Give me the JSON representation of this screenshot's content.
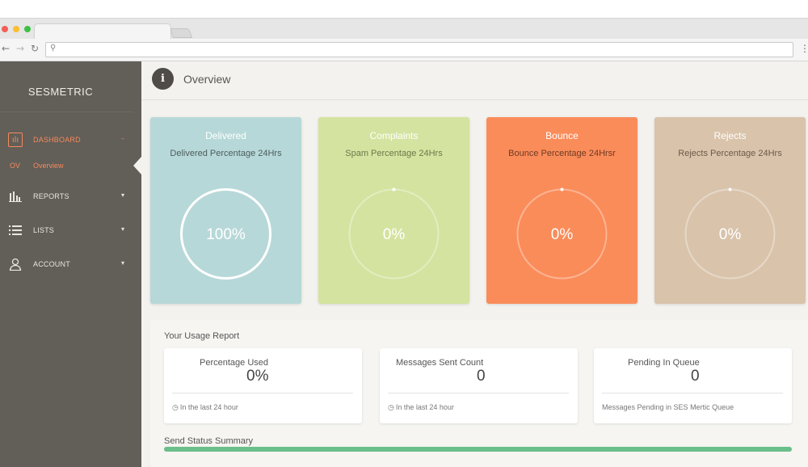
{
  "app": {
    "brand": "SESMETRIC",
    "page_title": "Overview"
  },
  "sidebar": {
    "items": [
      {
        "label": "DASHBOARD",
        "icon": "chart-icon",
        "caret": "–",
        "active": true
      },
      {
        "label": "REPORTS",
        "icon": "bar-chart-icon",
        "caret": "▾"
      },
      {
        "label": "LISTS",
        "icon": "list-icon",
        "caret": "▾"
      },
      {
        "label": "ACCOUNT",
        "icon": "user-icon",
        "caret": "▾"
      }
    ],
    "sub_item": {
      "code": "OV",
      "label": "Overview"
    }
  },
  "cards": [
    {
      "title": "Delivered",
      "subtitle": "Delivered Percentage 24Hrs",
      "value": "100%",
      "percent": 100,
      "bg": "#b7d8d8",
      "title_color": "#ffffff",
      "sub_color": "#4d5c5c"
    },
    {
      "title": "Complaints",
      "subtitle": "Spam Percentage 24Hrs",
      "value": "0%",
      "percent": 0,
      "bg": "#d4e3a0",
      "title_color": "#ffffff",
      "sub_color": "#6b7a4a"
    },
    {
      "title": "Bounce",
      "subtitle": "Bounce Percentage 24Hrsr",
      "value": "0%",
      "percent": 0,
      "bg": "#fa8c5a",
      "title_color": "#ffffff",
      "sub_color": "#6e3a22"
    },
    {
      "title": "Rejects",
      "subtitle": "Rejects Percentage 24Hrs",
      "value": "0%",
      "percent": 0,
      "bg": "#d9c3ab",
      "title_color": "#ffffff",
      "sub_color": "#6b5a4a"
    }
  ],
  "usage": {
    "title": "Your Usage Report",
    "stats": [
      {
        "label": "Percentage Used",
        "value": "0%",
        "footer": "In the last 24 hour",
        "clock": true
      },
      {
        "label": "Messages Sent Count",
        "value": "0",
        "footer": "In the last 24 hour",
        "clock": true
      },
      {
        "label": "Pending In Queue",
        "value": "0",
        "footer": "Messages Pending in SES Mertic Queue",
        "clock": false
      }
    ],
    "send_title": "Send Status Summary",
    "send_progress": 100
  },
  "colors": {
    "sidebar_bg": "#625e58",
    "accent": "#f58a5b",
    "progress": "#6bbf8a"
  }
}
